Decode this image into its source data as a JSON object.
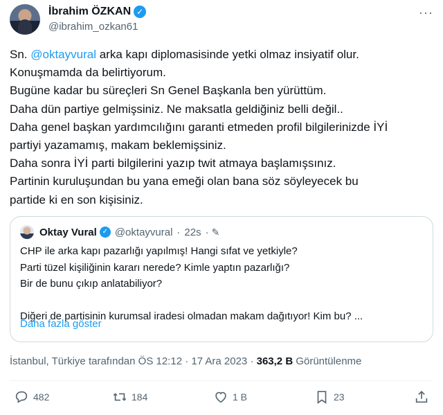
{
  "author": {
    "name": "İbrahim ÖZKAN",
    "handle": "@ibrahim_ozkan61"
  },
  "tweet": {
    "prefix": "Sn. ",
    "mention": "@oktayvural",
    "lines": [
      " arka kapı diplomasisinde yetki olmaz insiyatif olur.",
      "Konuşmamda da belirtiyorum.",
      "Bugüne kadar  bu süreçleri Sn Genel Başkanla ben yürüttüm.",
      "Daha dün partiye gelmişsiniz. Ne maksatla geldiğiniz belli değil..",
      "Daha genel başkan yardımcılığını garanti etmeden profil bilgilerinizde İYİ",
      "partiyi yazamamış, makam beklemişsiniz.",
      "Daha sonra İYİ parti bilgilerini yazıp twit atmaya başlamışsınız.",
      "Partinin  kuruluşundan bu yana emeği olan bana söz söyleyecek bu",
      "partide ki en son kişisiniz."
    ]
  },
  "quote": {
    "name": "Oktay Vural",
    "handle": "@oktayvural",
    "time": "22s",
    "lines": [
      "CHP ile arka kapı pazarlığı yapılmış! Hangi sıfat ve yetkiyle?",
      "Parti tüzel kişiliğinin kararı nerede? Kimle yaptın pazarlığı?",
      "Bir de bunu çıkıp anlatabiliyor?",
      "",
      "Diğeri de partisinin kurumsal iradesi olmadan makam dağıtıyor!  Kim bu? ..."
    ],
    "show_more": "Daha fazla göster"
  },
  "info": {
    "location": "İstanbul, Türkiye tarafından ÖS 12:12 · 17 Ara 2023 · ",
    "views": "363,2 B",
    "views_label": " Görüntülenme"
  },
  "actions": {
    "replies": "482",
    "retweets": "184",
    "likes": "1 B",
    "bookmarks": "23"
  },
  "icons": [
    "verified-badge-icon",
    "more-icon",
    "pencil-icon",
    "reply-icon",
    "retweet-icon",
    "like-icon",
    "bookmark-icon",
    "share-icon"
  ],
  "colors": {
    "link": "#1d9bf0",
    "secondary": "#536471",
    "border": "#cfd9de"
  }
}
